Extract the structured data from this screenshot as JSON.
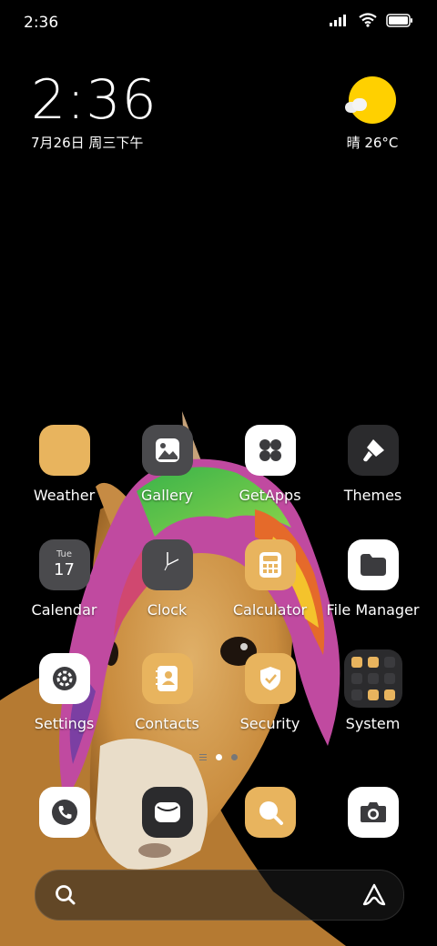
{
  "status_bar": {
    "time": "2:36"
  },
  "clock_widget": {
    "time": "2:36",
    "date": "7月26日 周三下午"
  },
  "weather_widget": {
    "condition_temp": "晴 26°C"
  },
  "apps": {
    "row1": [
      {
        "label": "Weather",
        "icon": "weather-icon"
      },
      {
        "label": "Gallery",
        "icon": "gallery-icon"
      },
      {
        "label": "GetApps",
        "icon": "getapps-icon"
      },
      {
        "label": "Themes",
        "icon": "themes-brush-icon"
      }
    ],
    "row2": [
      {
        "label": "Calendar",
        "icon": "calendar-icon",
        "day_name": "Tue",
        "day_number": "17"
      },
      {
        "label": "Clock",
        "icon": "clock-icon"
      },
      {
        "label": "Calculator",
        "icon": "calculator-icon"
      },
      {
        "label": "File Manager",
        "icon": "folder-icon"
      }
    ],
    "row3": [
      {
        "label": "Settings",
        "icon": "gear-icon"
      },
      {
        "label": "Contacts",
        "icon": "contacts-icon"
      },
      {
        "label": "Security",
        "icon": "shield-check-icon"
      },
      {
        "label": "System",
        "icon": "system-folder-icon"
      }
    ]
  },
  "dock": [
    {
      "name": "phone",
      "icon": "phone-icon"
    },
    {
      "name": "messages",
      "icon": "message-icon"
    },
    {
      "name": "browser",
      "icon": "browser-search-icon"
    },
    {
      "name": "camera",
      "icon": "camera-icon"
    }
  ],
  "page_indicator": {
    "pages": 2,
    "current": 1
  },
  "colors": {
    "accent_orange": "#e8b45e",
    "sun_yellow": "#ffd000",
    "icon_dark": "#4a4a4d"
  }
}
